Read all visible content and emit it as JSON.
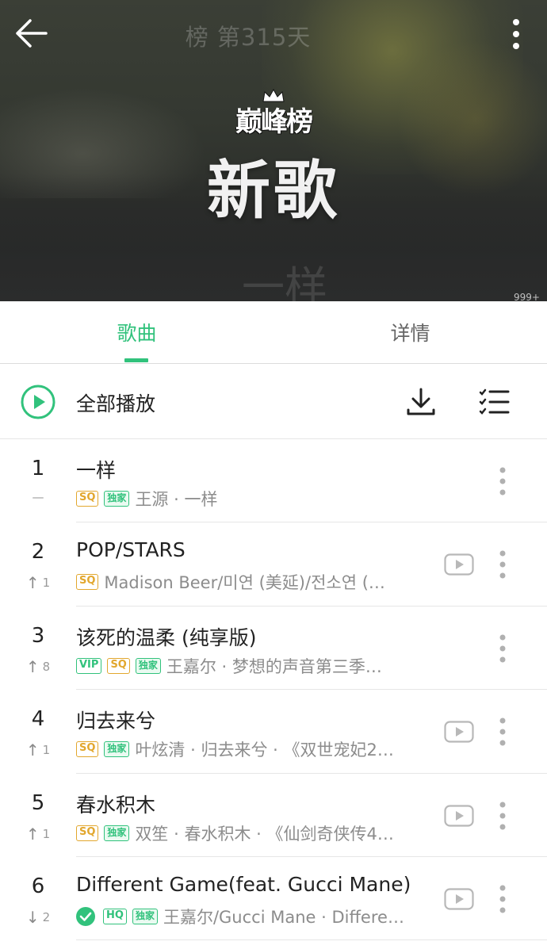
{
  "header": {
    "title": "榜 第315天",
    "logo_text": "巅峰榜",
    "chart_name": "新歌",
    "watermark": "一样",
    "comment_count": "999+"
  },
  "tabs": [
    {
      "label": "歌曲",
      "active": true
    },
    {
      "label": "详情",
      "active": false
    }
  ],
  "playall": {
    "label": "全部播放"
  },
  "colors": {
    "accent": "#31c27c",
    "sq": "#e2a72e"
  },
  "songs": [
    {
      "rank": "1",
      "trend": "—",
      "trend_dir": "none",
      "title": "一样",
      "badges": [
        "SQ",
        "独家"
      ],
      "verified": false,
      "artist": "王源 · 一样",
      "has_mv": false
    },
    {
      "rank": "2",
      "trend": "1",
      "trend_dir": "up",
      "title": "POP/STARS",
      "badges": [
        "SQ"
      ],
      "verified": false,
      "artist": "Madison Beer/미연 (美延)/전소연 (…",
      "has_mv": true
    },
    {
      "rank": "3",
      "trend": "8",
      "trend_dir": "up",
      "title": "该死的温柔 (纯享版)",
      "badges": [
        "VIP",
        "SQ",
        "独家"
      ],
      "verified": false,
      "artist": "王嘉尔 · 梦想的声音第三季…",
      "has_mv": false
    },
    {
      "rank": "4",
      "trend": "1",
      "trend_dir": "up",
      "title": "归去来兮",
      "badges": [
        "SQ",
        "独家"
      ],
      "verified": false,
      "artist": "叶炫清 · 归去来兮 · 《双世宠妃2…",
      "has_mv": true
    },
    {
      "rank": "5",
      "trend": "1",
      "trend_dir": "up",
      "title": "春水积木",
      "badges": [
        "SQ",
        "独家"
      ],
      "verified": false,
      "artist": "双笙 · 春水积木 · 《仙剑奇侠传4…",
      "has_mv": true
    },
    {
      "rank": "6",
      "trend": "2",
      "trend_dir": "down",
      "title": "Different Game(feat. Gucci Mane)",
      "badges": [
        "HQ",
        "独家"
      ],
      "verified": true,
      "artist": "王嘉尔/Gucci Mane · Differe…",
      "has_mv": true
    }
  ]
}
